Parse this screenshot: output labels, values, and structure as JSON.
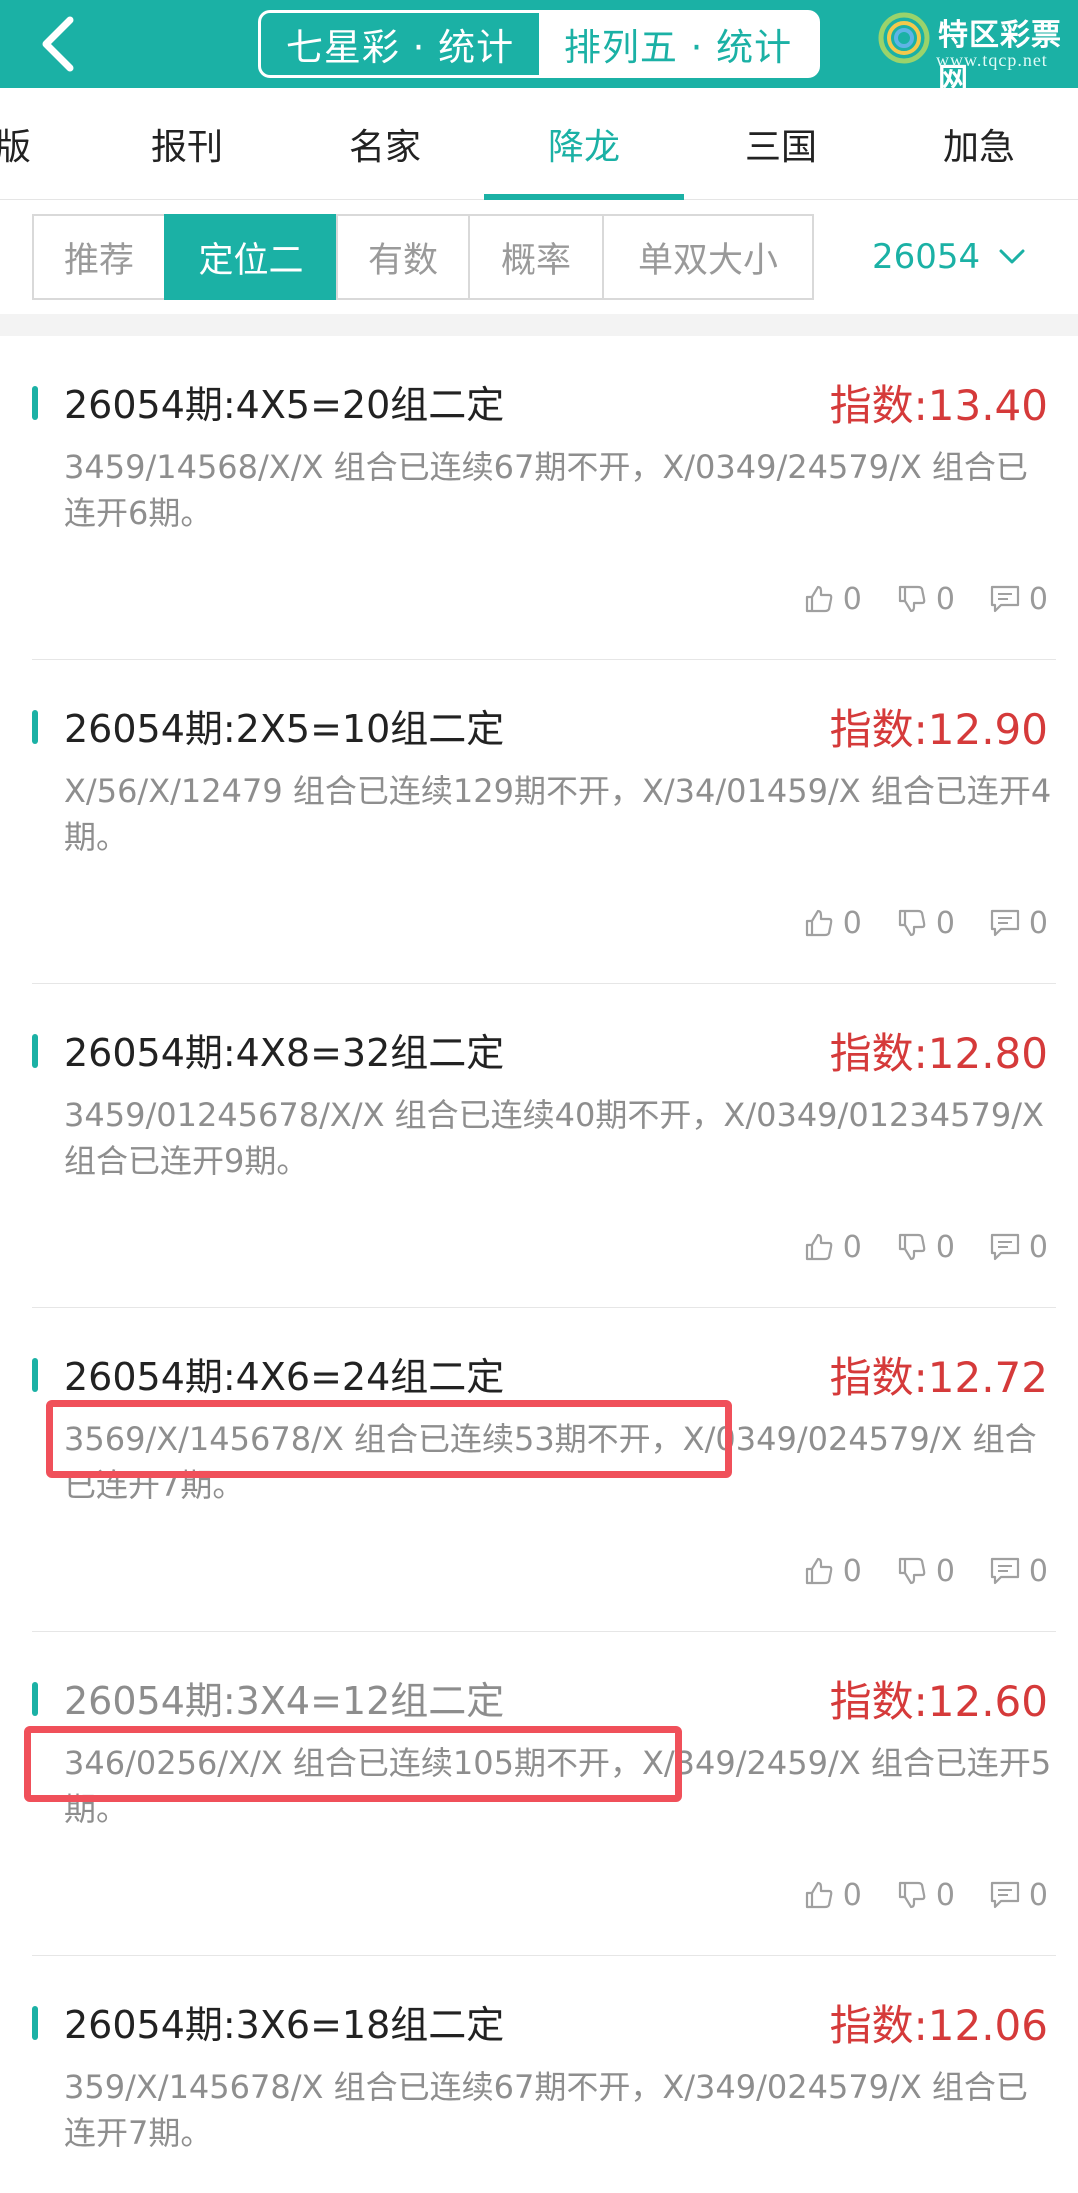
{
  "header": {
    "segments": [
      {
        "label": "七星彩 · 统计",
        "active": true
      },
      {
        "label": "排列五 · 统计",
        "active": false
      }
    ],
    "logo": {
      "name": "特区彩票网",
      "url": "www.tqcp.net"
    }
  },
  "tabs": [
    {
      "label": "版",
      "active": false
    },
    {
      "label": "报刊",
      "active": false
    },
    {
      "label": "名家",
      "active": false
    },
    {
      "label": "降龙",
      "active": true
    },
    {
      "label": "三国",
      "active": false
    },
    {
      "label": "加急",
      "active": false
    }
  ],
  "subtabs": [
    {
      "label": "推荐",
      "active": false
    },
    {
      "label": "定位二",
      "active": true
    },
    {
      "label": "有数",
      "active": false
    },
    {
      "label": "概率",
      "active": false
    },
    {
      "label": "单双大小",
      "active": false
    }
  ],
  "issue_select": {
    "value": "26054"
  },
  "cards": [
    {
      "title": "26054期:4X5=20组二定",
      "index": "指数:13.40",
      "desc": "3459/14568/X/X 组合已连续67期不开，X/0349/24579/X 组合已连开6期。",
      "likes": "0",
      "dislikes": "0",
      "comments": "0"
    },
    {
      "title": "26054期:2X5=10组二定",
      "index": "指数:12.90",
      "desc": "X/56/X/12479 组合已连续129期不开，X/34/01459/X 组合已连开4期。",
      "likes": "0",
      "dislikes": "0",
      "comments": "0"
    },
    {
      "title": "26054期:4X8=32组二定",
      "index": "指数:12.80",
      "desc": "3459/01245678/X/X 组合已连续40期不开，X/0349/01234579/X 组合已连开9期。",
      "likes": "0",
      "dislikes": "0",
      "comments": "0"
    },
    {
      "title": "26054期:4X6=24组二定",
      "index": "指数:12.72",
      "desc": "3569/X/145678/X 组合已连续53期不开，X/0349/024579/X 组合已连开7期。",
      "likes": "0",
      "dislikes": "0",
      "comments": "0"
    },
    {
      "title": "26054期:3X4=12组二定",
      "index": "指数:12.60",
      "desc": "346/0256/X/X 组合已连续105期不开，X/349/2459/X 组合已连开5期。",
      "likes": "0",
      "dislikes": "0",
      "comments": "0"
    },
    {
      "title": "26054期:3X6=18组二定",
      "index": "指数:12.06",
      "desc": "359/X/145678/X 组合已连续67期不开，X/349/024579/X 组合已连开7期。",
      "likes": "0",
      "dislikes": "0",
      "comments": "0"
    }
  ],
  "colors": {
    "brand_teal": "#1bb1a5",
    "index_red": "#d53a3a",
    "highlight_red": "#f0505a"
  }
}
